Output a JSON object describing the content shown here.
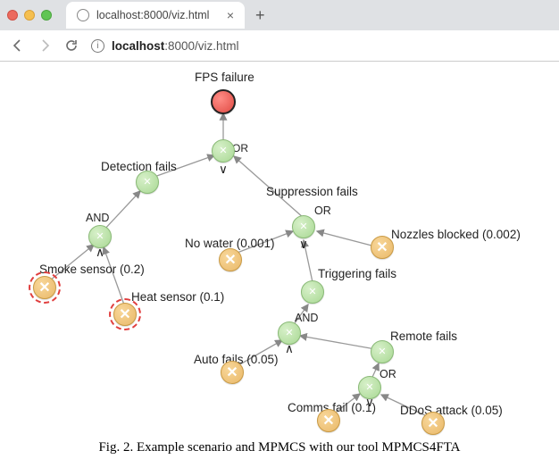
{
  "browser": {
    "tab_title": "localhost:8000/viz.html",
    "url_host": "localhost",
    "url_rest": ":8000/viz.html",
    "newtab": "+",
    "close": "×"
  },
  "tree": {
    "root": {
      "label": "FPS failure"
    },
    "gates": {
      "g_main": {
        "op": "OR",
        "sym": "∨"
      },
      "g_det": {
        "op": "AND",
        "sym": "∧",
        "label": "Detection fails"
      },
      "g_sup": {
        "op": "OR",
        "sym": "∨",
        "label": "Suppression fails"
      },
      "g_trig": {
        "op": "AND",
        "sym": "∧",
        "label": "Triggering fails"
      },
      "g_remote": {
        "op": "OR",
        "sym": "∨",
        "label": "Remote fails"
      }
    },
    "leaves": {
      "smoke": {
        "label": "Smoke sensor (0.2)",
        "highlighted": true
      },
      "heat": {
        "label": "Heat sensor (0.1)",
        "highlighted": true
      },
      "nowater": {
        "label": "No water (0.001)"
      },
      "nozzle": {
        "label": "Nozzles blocked (0.002)"
      },
      "auto": {
        "label": "Auto fails (0.05)"
      },
      "comms": {
        "label": "Comms fail (0.1)"
      },
      "ddos": {
        "label": "DDoS attack (0.05)"
      }
    }
  },
  "figure_caption": "Fig. 2.   Example scenario and MPMCS with our tool MPMCS4FTA"
}
